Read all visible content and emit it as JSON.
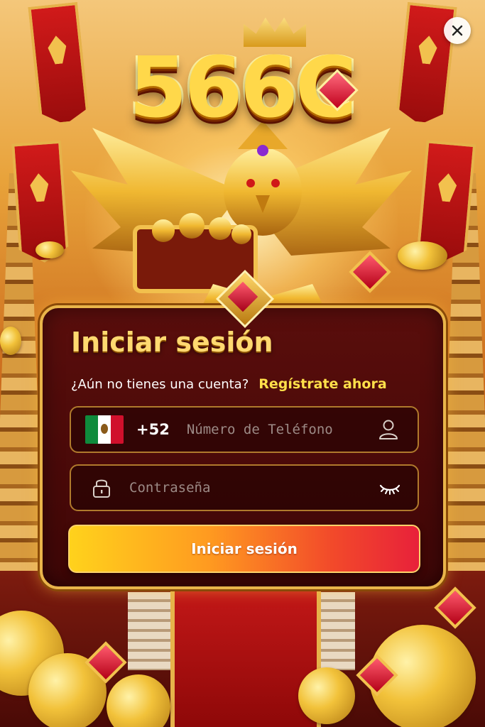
{
  "brand": {
    "logo_text": "566C"
  },
  "close": {
    "label": "×"
  },
  "login": {
    "title": "Iniciar sesión",
    "no_account_text": "¿Aún no tienes una cuenta?",
    "register_link": "Regístrate ahora",
    "phone": {
      "country_code": "+52",
      "flag": "mexico-flag",
      "placeholder": "Número de Teléfono",
      "value": ""
    },
    "password": {
      "placeholder": "Contraseña",
      "value": ""
    },
    "submit_label": "Iniciar sesión"
  },
  "icons": {
    "close": "close-icon",
    "user": "user-icon",
    "lock": "lock-icon",
    "eye": "eye-closed-icon"
  },
  "colors": {
    "accent_gold": "#ffd970",
    "link_yellow": "#ffe04a",
    "panel_bg": "#4a0a08",
    "button_start": "#ffd21c",
    "button_end": "#e8213a"
  }
}
